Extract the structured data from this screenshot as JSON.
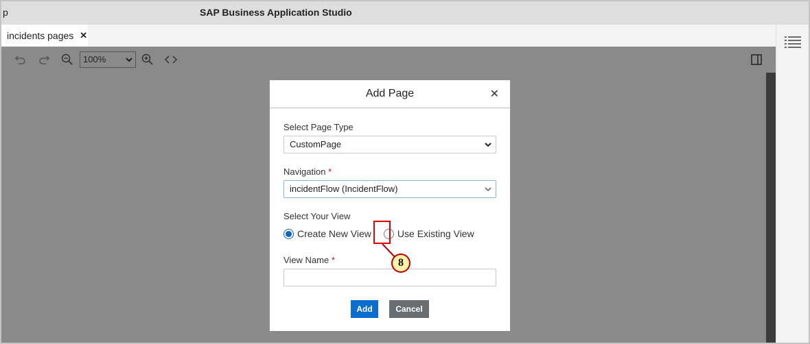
{
  "window": {
    "title_stub": "p",
    "title": "SAP Business Application Studio"
  },
  "tabs": [
    {
      "label": "incidents pages",
      "close": "✕"
    }
  ],
  "toolbar": {
    "zoom": "100%",
    "icons": [
      "undo-icon",
      "redo-icon",
      "zoom-out-icon",
      "zoom-in-icon",
      "code-icon",
      "panel-toggle-icon"
    ]
  },
  "dialog": {
    "title": "Add Page",
    "close": "✕",
    "page_type": {
      "label": "Select Page Type",
      "value": "CustomPage"
    },
    "navigation": {
      "label": "Navigation",
      "required": "*",
      "value": "incidentFlow (IncidentFlow)"
    },
    "view": {
      "label": "Select Your View",
      "options": [
        {
          "label": "Create New View",
          "checked": true
        },
        {
          "label": "Use Existing View",
          "checked": false
        }
      ]
    },
    "view_name": {
      "label": "View Name",
      "required": "*",
      "value": ""
    },
    "buttons": {
      "add": "Add",
      "cancel": "Cancel"
    }
  },
  "annotation": {
    "step": "8"
  },
  "colors": {
    "accent": "#0a6ed1",
    "annotation_red": "#e00000",
    "badge_fill": "#fff3a8"
  }
}
